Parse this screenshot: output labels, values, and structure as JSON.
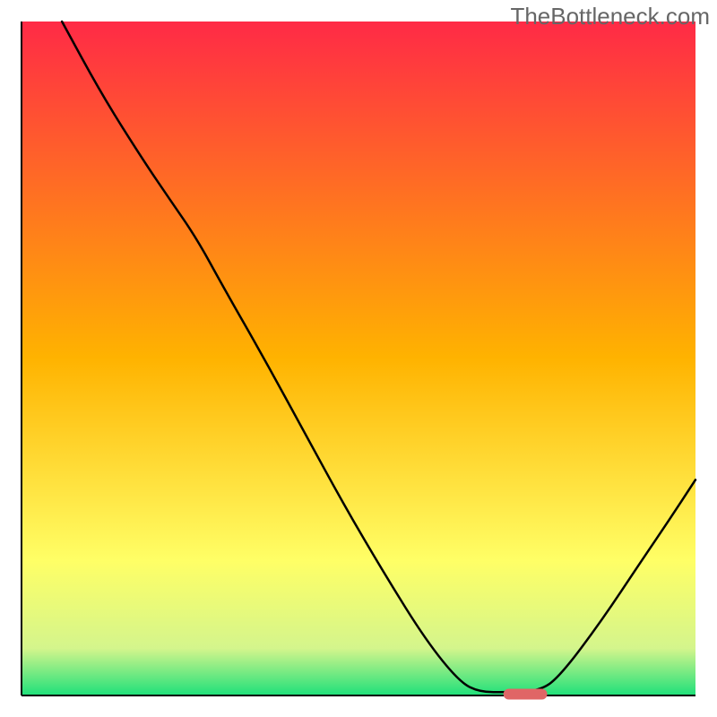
{
  "watermark": "TheBottleneck.com",
  "chart_data": {
    "type": "line",
    "title": "",
    "xlabel": "",
    "ylabel": "",
    "xlim": [
      0,
      100
    ],
    "ylim": [
      0,
      100
    ],
    "gradient_stops": [
      {
        "offset": 0,
        "color": "#ff2a46"
      },
      {
        "offset": 50,
        "color": "#ffb300"
      },
      {
        "offset": 80,
        "color": "#ffff66"
      },
      {
        "offset": 93,
        "color": "#d4f58c"
      },
      {
        "offset": 100,
        "color": "#1ee07a"
      }
    ],
    "curve_points": [
      [
        6.0,
        100.0
      ],
      [
        12.0,
        89.0
      ],
      [
        18.0,
        79.5
      ],
      [
        22.0,
        73.6
      ],
      [
        26.0,
        67.8
      ],
      [
        30.0,
        60.5
      ],
      [
        36.0,
        50.0
      ],
      [
        42.0,
        39.0
      ],
      [
        48.0,
        28.0
      ],
      [
        54.0,
        17.8
      ],
      [
        60.0,
        8.2
      ],
      [
        65.0,
        2.0
      ],
      [
        68.0,
        0.5
      ],
      [
        72.0,
        0.5
      ],
      [
        77.0,
        0.7
      ],
      [
        80.0,
        3.0
      ],
      [
        86.0,
        11.0
      ],
      [
        92.0,
        20.0
      ],
      [
        96.0,
        25.9
      ],
      [
        100.0,
        32.0
      ]
    ],
    "marker": {
      "x": 71.5,
      "y": 0.2,
      "width": 6.5,
      "color": "#e06666"
    },
    "axes": {
      "x_axis_y": 0,
      "y_axis_x": 6.0,
      "right_axis_x": 100,
      "color": "#000000",
      "thickness": 2
    }
  }
}
